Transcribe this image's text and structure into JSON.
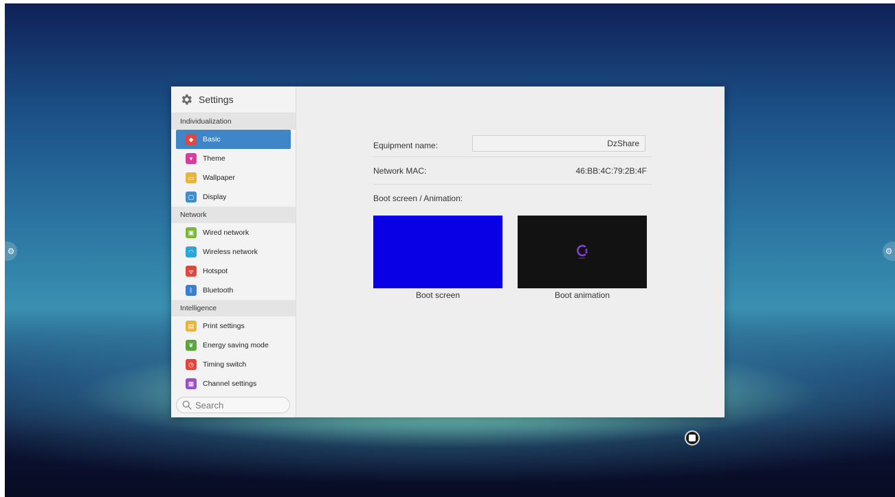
{
  "window": {
    "title": "Settings"
  },
  "sidebar": {
    "sections": [
      {
        "label": "Individualization"
      },
      {
        "label": "Network"
      },
      {
        "label": "Intelligence"
      }
    ],
    "items": [
      {
        "label": "Basic",
        "icon": "layers-icon",
        "color": "#e2453c",
        "active": true
      },
      {
        "label": "Theme",
        "icon": "shirt-icon",
        "color": "#d83c9d"
      },
      {
        "label": "Wallpaper",
        "icon": "image-icon",
        "color": "#e8b43a"
      },
      {
        "label": "Display",
        "icon": "monitor-icon",
        "color": "#3b8fd0"
      },
      {
        "label": "Wired network",
        "icon": "ethernet-icon",
        "color": "#7ab83a"
      },
      {
        "label": "Wireless network",
        "icon": "wifi-icon",
        "color": "#2ba6d9"
      },
      {
        "label": "Hotspot",
        "icon": "hotspot-icon",
        "color": "#e2453c"
      },
      {
        "label": "Bluetooth",
        "icon": "bluetooth-icon",
        "color": "#3b7fd0"
      },
      {
        "label": "Print settings",
        "icon": "printer-icon",
        "color": "#e8b43a"
      },
      {
        "label": "Energy saving mode",
        "icon": "leaf-icon",
        "color": "#5aa63a"
      },
      {
        "label": "Timing switch",
        "icon": "clock-icon",
        "color": "#e2453c"
      },
      {
        "label": "Channel settings",
        "icon": "channel-icon",
        "color": "#9b4fc6"
      }
    ],
    "search_placeholder": "Search"
  },
  "basic": {
    "equipment_name_label": "Equipment name:",
    "equipment_name_value": "DzShare",
    "network_mac_label": "Network MAC:",
    "network_mac_value": "46:BB:4C:79:2B:4F",
    "boot_label": "Boot screen / Animation:",
    "boot_screen_caption": "Boot screen",
    "boot_animation_caption": "Boot animation",
    "boot_screen_color": "#0a00e6",
    "boot_animation_color": "#121212"
  }
}
